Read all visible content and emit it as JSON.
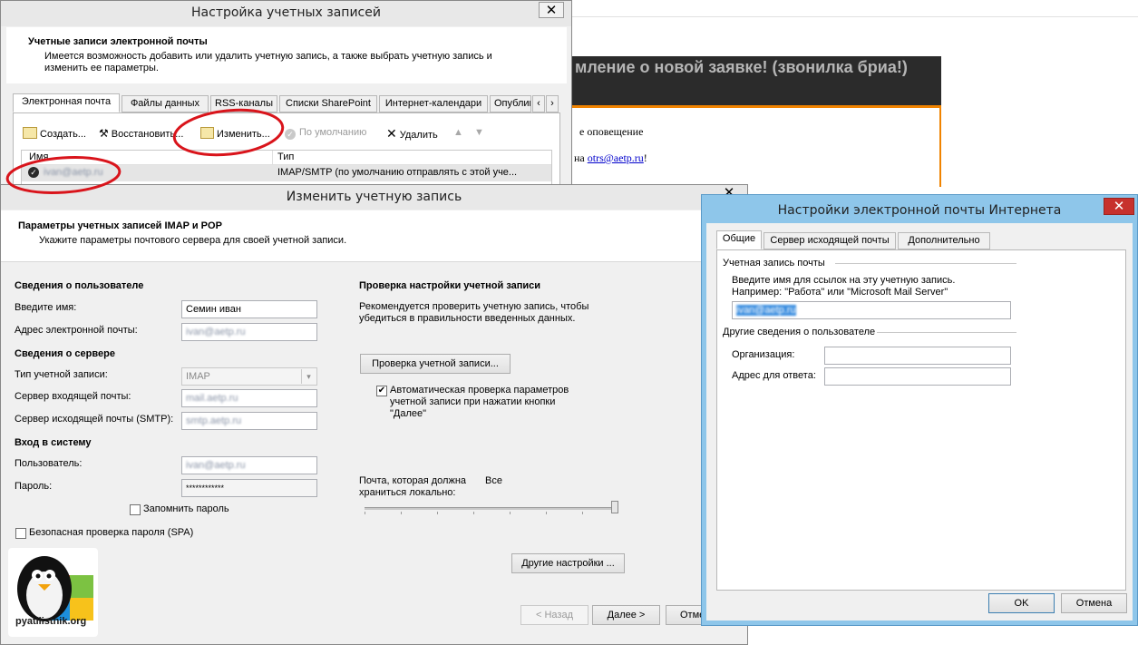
{
  "colors": {
    "banner": "#2b2b2b",
    "banner_text": "#b5b5b5",
    "accent_orange": "#f08300",
    "link": "#0000cc",
    "frame_blue": "#8ec6ea",
    "highlight_red": "#d9141b"
  },
  "background": {
    "headline": "мление о новой заявке! (звонилка бриа!)",
    "line1": "е оповещение",
    "line2_prefix": "на ",
    "line2_link": "otrs@aetp.ru",
    "line2_suffix": "!"
  },
  "account_settings": {
    "title": "Настройка учетных записей",
    "close": "✕",
    "header_title": "Учетные записи электронной почты",
    "header_desc": "Имеется возможность добавить или удалить учетную запись, а также выбрать учетную запись и изменить ее параметры.",
    "tabs": [
      "Электронная почта",
      "Файлы данных",
      "RSS-каналы",
      "Списки SharePoint",
      "Интернет-календари",
      "Опублико"
    ],
    "toolbar": {
      "create": "Создать...",
      "restore": "Восстановить...",
      "change": "Изменить...",
      "default": "По умолчанию",
      "delete": "Удалить"
    },
    "list_headers": {
      "name": "Имя",
      "type": "Тип"
    },
    "row": {
      "name": "ivan@aetp.ru",
      "type": "IMAP/SMTP (по умолчанию отправлять с этой уче..."
    }
  },
  "change_account": {
    "title": "Изменить учетную запись",
    "close": "✕",
    "header_title": "Параметры учетных записей IMAP и POP",
    "header_desc": "Укажите параметры почтового сервера для своей учетной записи.",
    "user_info": "Сведения о пользователе",
    "name_label": "Введите имя:",
    "name_value": "Семин иван",
    "email_label": "Адрес электронной почты:",
    "email_value": "ivan@aetp.ru",
    "server_info": "Сведения о сервере",
    "account_type_label": "Тип учетной записи:",
    "account_type_value": "IMAP",
    "incoming_label": "Сервер входящей почты:",
    "incoming_value": "mail.aetp.ru",
    "outgoing_label": "Сервер исходящей почты (SMTP):",
    "outgoing_value": "smtp.aetp.ru",
    "login_info": "Вход в систему",
    "user_label": "Пользователь:",
    "user_value": "ivan@aetp.ru",
    "password_label": "Пароль:",
    "password_value": "************",
    "remember_password": "Запомнить пароль",
    "spa": "Безопасная проверка пароля (SPA)",
    "test_title": "Проверка настройки учетной записи",
    "test_desc": "Рекомендуется проверить учетную запись, чтобы убедиться в правильности введенных данных.",
    "test_button": "Проверка учетной записи...",
    "auto_check": "Автоматическая проверка параметров учетной записи при нажатии кнопки \"Далее\"",
    "keep_offline_label": "Почта, которая должна храниться локально:",
    "keep_offline_value": "Все",
    "keep_offline_level": 1.0,
    "more_settings": "Другие настройки ...",
    "back": "< Назад",
    "next": "Далее >",
    "cancel": "Отме"
  },
  "internet_settings": {
    "title": "Настройки электронной почты Интернета",
    "close": "✕",
    "tabs": [
      "Общие",
      "Сервер исходящей почты",
      "Дополнительно"
    ],
    "account_group": "Учетная запись почты",
    "account_desc1": "Введите имя для ссылок на эту учетную запись.",
    "account_desc2": "Например: \"Работа\" или \"Microsoft Mail Server\"",
    "account_value": "ivan@aetp.ru",
    "other_group": "Другие сведения о пользователе",
    "org_label": "Организация:",
    "reply_label": "Адрес для ответа:",
    "ok": "OK",
    "cancel": "Отмена"
  },
  "logo": {
    "text": "pyatilistnik.org"
  }
}
